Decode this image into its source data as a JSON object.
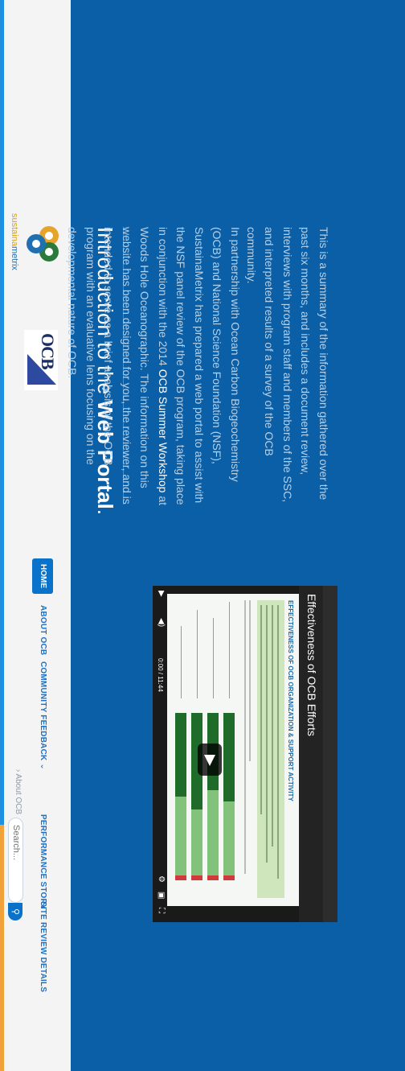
{
  "header": {
    "logo_sustainametrix": {
      "name_part1": "sustaina",
      "name_part2": "metrix"
    },
    "logo_ocb": {
      "text": "OCB"
    },
    "nav": {
      "home": "HOME",
      "about": "ABOUT OCB",
      "community": "COMMUNITY FEEDBACK",
      "performance": "PERFORMANCE STORY",
      "site_review": "SITE REVIEW DETAILS"
    },
    "breadcrumb": "› About OCB",
    "search": {
      "placeholder": "Search..."
    }
  },
  "main": {
    "title_prefix": "Introduction to the ",
    "title_bold": "Web Portal",
    "title_suffix": ".",
    "para1_a": "In partnership with Ocean Carbon Biogeochemistry (OCB) and National Science Foundation (NSF), SustainaMetrix has prepared a web portal to assist with the NSF panel review of the OCB program, taking place in conjunction with the 2014 ",
    "para1_link": "OCB Summer Workshop",
    "para1_b": " at Woods Hole Oceanographic. The information on this website has been designed for you, the reviewer, and is intended to serve as a brief analysis of the OCB program with an evaluative lens focusing on the developmental nature of OCB.",
    "para2": "This is a summary of the information gathered over the past six months, and includes a document review, interviews with program staff and members of the SSC, and interpreted results of a survey of the OCB community."
  },
  "video": {
    "title": "Effectiveness of OCB Efforts",
    "slide_heading": "EFFECTIVENESS OF OCB ORGANIZATION & SUPPORT ACTIVITY",
    "time": "0:00 / 11:44"
  }
}
